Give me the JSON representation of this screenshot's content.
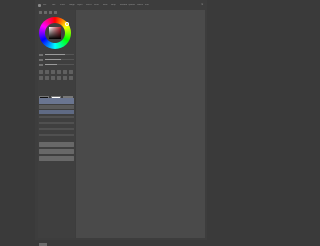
{
  "menubar": {
    "items": [
      "File",
      "Edit",
      "View",
      "Image",
      "Layer",
      "Select",
      "Filter",
      "Tools",
      "Help",
      "Window",
      "Options",
      "Panels",
      "Info"
    ],
    "close_label": "×"
  },
  "colors": {
    "primary": "#101010",
    "secondary": "#ffffff",
    "hue": "#b71c2a",
    "layer_highlight": "#6a7590"
  },
  "sliders": [
    0.7,
    0.55,
    0.4
  ],
  "buttons": [
    "",
    "",
    ""
  ]
}
